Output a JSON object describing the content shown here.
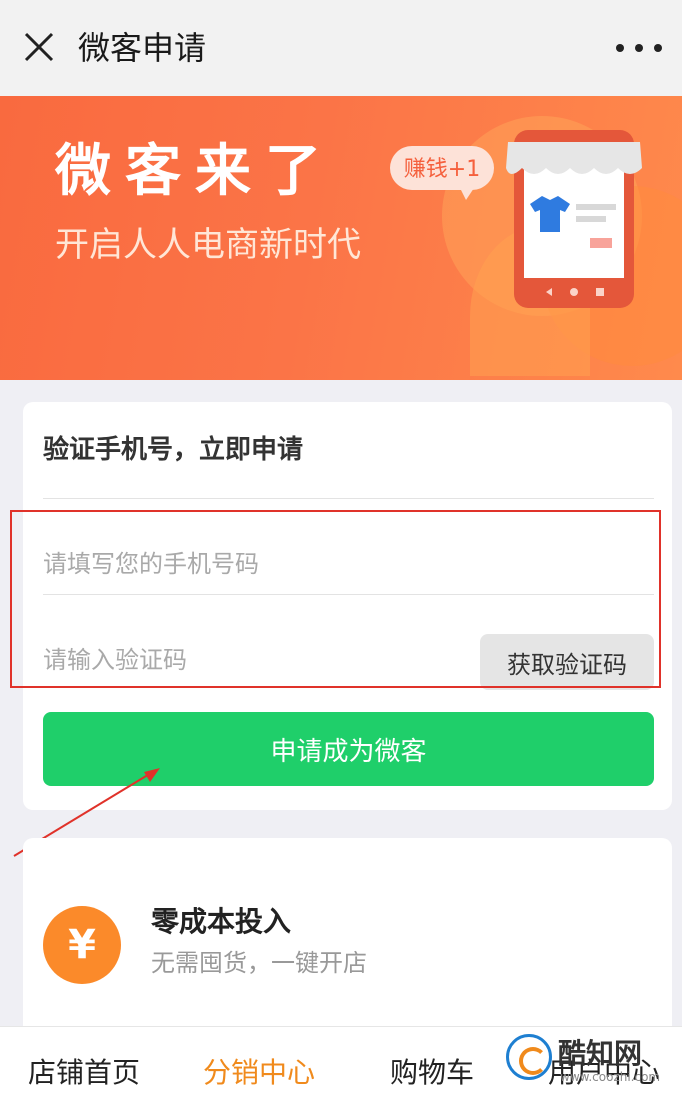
{
  "header": {
    "title": "微客申请",
    "close_icon": "close-icon",
    "more_icon": "more-dots-icon"
  },
  "banner": {
    "title": "微客来了",
    "subtitle": "开启人人电商新时代",
    "bubble": "赚钱+1",
    "colors": {
      "start": "#f96a3f",
      "end": "#ff8a4c"
    }
  },
  "form": {
    "heading": "验证手机号，立即申请",
    "phone_placeholder": "请填写您的手机号码",
    "phone_value": "",
    "code_placeholder": "请输入验证码",
    "code_value": "",
    "get_code_label": "获取验证码",
    "submit_label": "申请成为微客",
    "submit_color": "#1fcf6a"
  },
  "feature": {
    "icon_symbol": "¥",
    "title": "零成本投入",
    "description": "无需囤货，一键开店"
  },
  "bottom_nav": {
    "items": [
      {
        "label": "店铺首页",
        "active": false
      },
      {
        "label": "分销中心",
        "active": true
      },
      {
        "label": "购物车",
        "active": false
      },
      {
        "label": "用户中心",
        "active": false
      }
    ],
    "active_color": "#f08a1c"
  },
  "watermark": {
    "name": "酷知网",
    "url": "www.coozhi.com"
  }
}
